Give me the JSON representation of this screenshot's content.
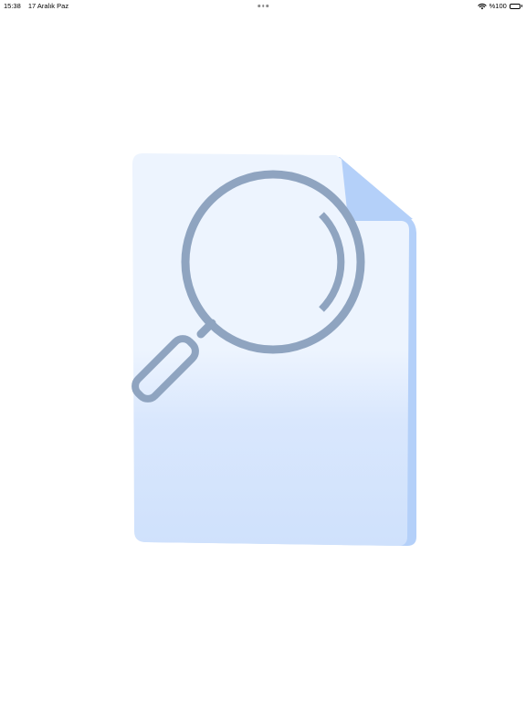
{
  "status_bar": {
    "time": "15:38",
    "date": "17 Aralık Paz",
    "battery_text": "%100",
    "battery_level": 1.0
  },
  "main": {
    "illustration_icon": "document-search-icon"
  },
  "colors": {
    "document_top": "#edf4fe",
    "document_bottom": "#cfe1fc",
    "document_fold": "#b4d0f9",
    "magnifier_stroke": "#8fa4c0"
  }
}
